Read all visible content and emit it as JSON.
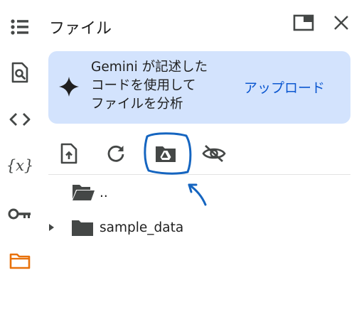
{
  "nav_rail": {
    "items": [
      {
        "name": "table-of-contents",
        "icon": "toc-icon"
      },
      {
        "name": "find-and-replace",
        "icon": "find-in-page-icon"
      },
      {
        "name": "code-snippets",
        "icon": "code-brackets-icon"
      },
      {
        "name": "variables",
        "icon": "variables-x-icon",
        "label": "{x}"
      },
      {
        "name": "secrets",
        "icon": "key-icon"
      },
      {
        "name": "files",
        "icon": "folder-icon",
        "active": true
      }
    ],
    "active_color": "#e8710a",
    "icon_color": "#444746"
  },
  "panel": {
    "title": "ファイル",
    "header_icons": [
      "open-in-tab-icon",
      "close-icon"
    ]
  },
  "banner": {
    "icon": "sparkle-icon",
    "message": "Gemini が記述した\nコードを使用して\nファイルを分析",
    "action_label": "アップロード",
    "background": "#d3e3fd",
    "action_color": "#0b57d0"
  },
  "toolbar": {
    "buttons": [
      "upload-file-icon",
      "refresh-icon",
      "mount-drive-icon",
      "hide-files-icon"
    ]
  },
  "file_tree": {
    "items": [
      {
        "name": "..",
        "icon": "folder-open-icon",
        "expandable": false
      },
      {
        "name": "sample_data",
        "icon": "folder-icon",
        "expandable": true
      }
    ]
  },
  "annotation_color": "#1565c0"
}
